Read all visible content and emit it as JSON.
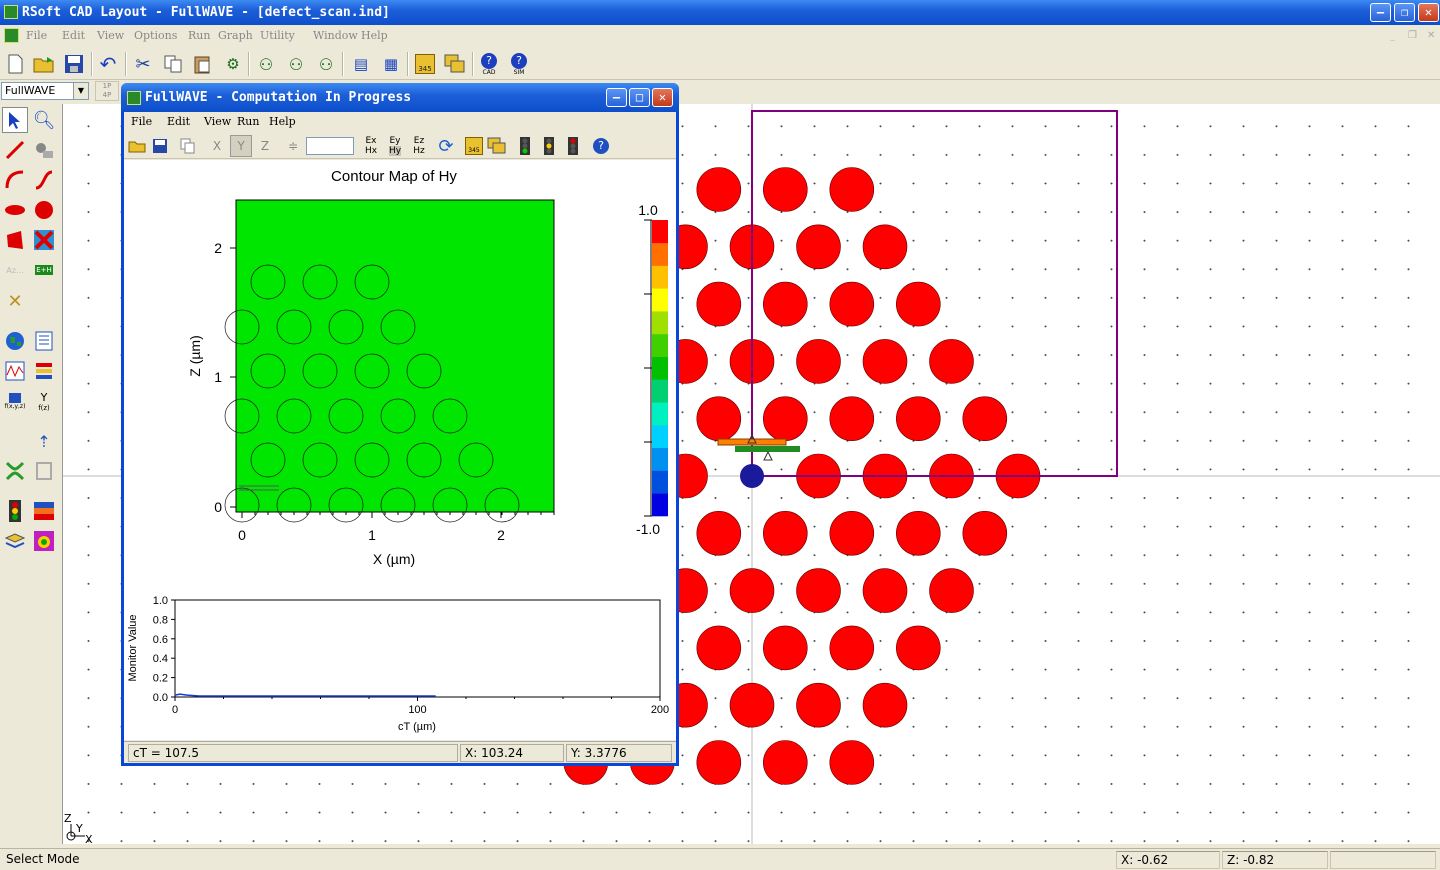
{
  "app": {
    "title": "RSoft CAD Layout - FullWAVE - [defect_scan.ind]"
  },
  "menu": [
    "File",
    "Edit",
    "View",
    "Options",
    "Run",
    "Graph",
    "Utility",
    "Window",
    "Help"
  ],
  "mode_combo": {
    "value": "FullWAVE"
  },
  "small_toggle": {
    "top": "1P",
    "bottom": "4P"
  },
  "toolbar_icons": [
    "new-file",
    "open-folder",
    "save",
    "undo",
    "cut",
    "copy",
    "paste",
    "group",
    "insert-a",
    "insert-b",
    "insert-c",
    "align-a",
    "align-b",
    "table-345",
    "cascade",
    "help-cad",
    "help-sim"
  ],
  "toolbar_labels": {
    "table": "345",
    "help_cad": "CAD",
    "help_sim": "SIM"
  },
  "left_tools": [
    "select-arrow",
    "zoom",
    "line-segment",
    "multi-component",
    "arc",
    "s-bend",
    "ellipse",
    "sphere",
    "polygon",
    "taper",
    "annotation",
    "e-h-label",
    "utility-tools",
    "globe",
    "text-list",
    "waveform",
    "layers",
    "f-xyz",
    "f-z",
    "launch-rocket",
    "coupler",
    "monitor-box",
    "traffic-light",
    "layer-stack",
    "stack-toggle",
    "color-map"
  ],
  "left_tool_labels": {
    "eh": "E+H",
    "fxyz": "f(x,y,z)",
    "fz": "f(z)"
  },
  "canvas": {
    "axis_z": "Z",
    "axis_y": "Y",
    "axis_x": "X",
    "rod_color": "#ff0000",
    "boundary_color": "#800080",
    "launch_color": "#ff8000",
    "monitor_color": "#228b22",
    "defect_color": "#1a1a9a"
  },
  "status": {
    "mode": "Select Mode",
    "x": "X: -0.62",
    "z": "Z: -0.82"
  },
  "fullwave": {
    "title": "FullWAVE - Computation In Progress",
    "menu": [
      "File",
      "Edit",
      "View",
      "Run",
      "Help"
    ],
    "toolbar": {
      "axes": [
        "X",
        "Y",
        "Z"
      ],
      "field_top": [
        "Ex",
        "Ey",
        "Ez"
      ],
      "field_bottom": [
        "Hx",
        "Hy",
        "Hz"
      ],
      "table_label": "345",
      "spin_value": ""
    },
    "contour": {
      "title": "Contour Map of Hy",
      "xlabel": "X (µm)",
      "ylabel": "Z (µm)",
      "xticks": [
        "0",
        "1",
        "2"
      ],
      "yticks": [
        "0",
        "1",
        "2"
      ],
      "fill_color": "#00e600",
      "colorbar": {
        "max": "1.0",
        "min": "-1.0",
        "colors": [
          "#0000e0",
          "#0050e0",
          "#0090f0",
          "#00d0ff",
          "#00f0c0",
          "#00d070",
          "#00c000",
          "#40d000",
          "#a0e000",
          "#ffff00",
          "#ffc000",
          "#ff7000",
          "#ff0000"
        ]
      }
    },
    "monitor": {
      "ylabel": "Monitor Value",
      "xlabel": "cT (µm)",
      "yticks": [
        "0.0",
        "0.2",
        "0.4",
        "0.6",
        "0.8",
        "1.0"
      ],
      "xticks": [
        "0",
        "100",
        "200"
      ]
    },
    "status": {
      "ct": "cT = 107.5",
      "x": "X: 103.24",
      "y": "Y: 3.3776"
    }
  },
  "chart_data": {
    "type": "line",
    "title": "",
    "xlabel": "cT (µm)",
    "ylabel": "Monitor Value",
    "xlim": [
      0,
      200
    ],
    "ylim": [
      0,
      1.0
    ],
    "series": [
      {
        "x": [
          0,
          2,
          5,
          10,
          20,
          40,
          60,
          80,
          100,
          107.5
        ],
        "values": [
          0.02,
          0.03,
          0.02,
          0.01,
          0.01,
          0.01,
          0.01,
          0.01,
          0.01,
          0.01
        ]
      }
    ]
  }
}
